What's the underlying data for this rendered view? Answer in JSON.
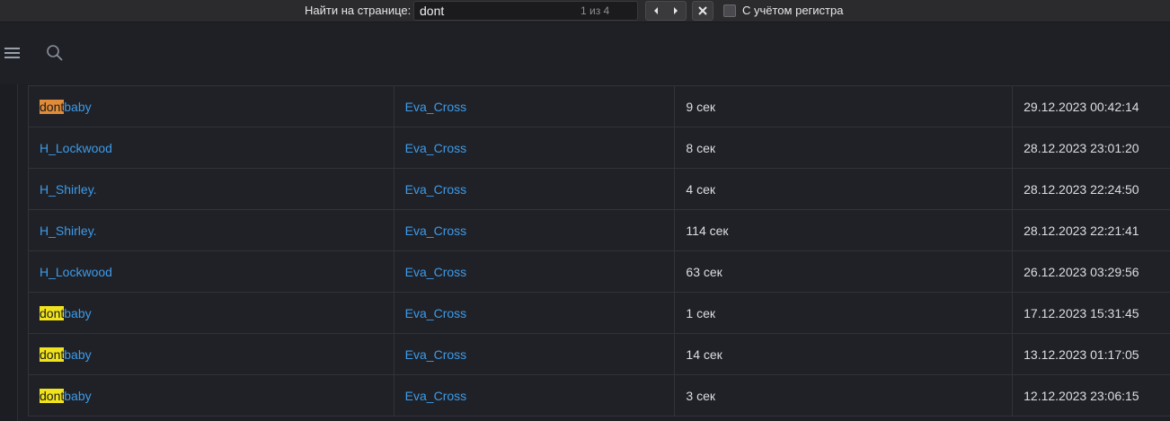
{
  "findbar": {
    "label": "Найти на странице:",
    "query": "dont",
    "count": "1 из 4",
    "match_case_label": "С учётом регистра",
    "match_case_checked": false
  },
  "table": {
    "rows": [
      {
        "user_prefix": "dont",
        "user_suffix": "baby",
        "user": "",
        "admin": "Eva_Cross",
        "duration": "9 сек",
        "datetime": "29.12.2023 00:42:14",
        "highlight": "active"
      },
      {
        "user_prefix": "",
        "user_suffix": "",
        "user": "H_Lockwood",
        "admin": "Eva_Cross",
        "duration": "8 сек",
        "datetime": "28.12.2023 23:01:20",
        "highlight": "none"
      },
      {
        "user_prefix": "",
        "user_suffix": "",
        "user": "H_Shirley.",
        "admin": "Eva_Cross",
        "duration": "4 сек",
        "datetime": "28.12.2023 22:24:50",
        "highlight": "none"
      },
      {
        "user_prefix": "",
        "user_suffix": "",
        "user": "H_Shirley.",
        "admin": "Eva_Cross",
        "duration": "114 сек",
        "datetime": "28.12.2023 22:21:41",
        "highlight": "none"
      },
      {
        "user_prefix": "",
        "user_suffix": "",
        "user": "H_Lockwood",
        "admin": "Eva_Cross",
        "duration": "63 сек",
        "datetime": "26.12.2023 03:29:56",
        "highlight": "none"
      },
      {
        "user_prefix": "dont",
        "user_suffix": "baby",
        "user": "",
        "admin": "Eva_Cross",
        "duration": "1 сек",
        "datetime": "17.12.2023 15:31:45",
        "highlight": "match"
      },
      {
        "user_prefix": "dont",
        "user_suffix": "baby",
        "user": "",
        "admin": "Eva_Cross",
        "duration": "14 сек",
        "datetime": "13.12.2023 01:17:05",
        "highlight": "match"
      },
      {
        "user_prefix": "dont",
        "user_suffix": "baby",
        "user": "",
        "admin": "Eva_Cross",
        "duration": "3 сек",
        "datetime": "12.12.2023 23:06:15",
        "highlight": "match"
      }
    ]
  },
  "colors": {
    "link": "#3d9be9",
    "match_highlight": "#f0e31d",
    "active_match_highlight": "#e08b3a"
  },
  "icons": {
    "menu": "menu-icon",
    "search": "search-icon",
    "prev": "chevron-left-icon",
    "next": "chevron-right-icon",
    "close": "close-icon"
  }
}
